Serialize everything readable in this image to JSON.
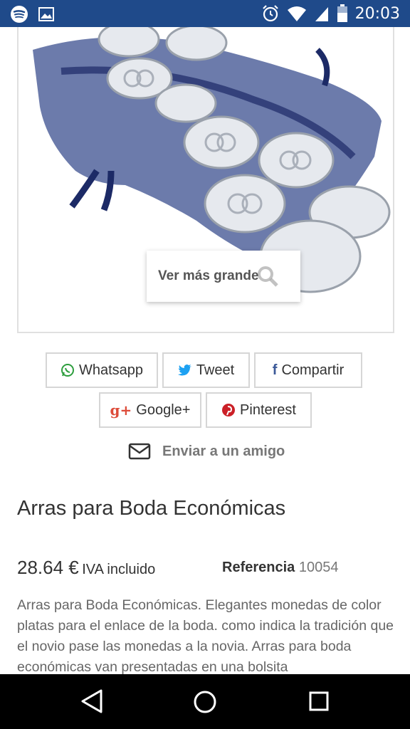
{
  "status_bar": {
    "time": "20:03",
    "icons": [
      "spotify-icon",
      "image-icon",
      "alarm-icon",
      "wifi-icon",
      "signal-icon",
      "battery-icon"
    ]
  },
  "product_image": {
    "zoom_label": "Ver más grande"
  },
  "share": {
    "whatsapp": "Whatsapp",
    "tweet": "Tweet",
    "compartir": "Compartir",
    "googleplus": "Google+",
    "pinterest": "Pinterest",
    "send_friend": "Enviar a un amigo"
  },
  "product": {
    "title": "Arras para Boda Económicas",
    "price": "28.64 €",
    "tax_note": "IVA incluido",
    "reference_label": "Referencia",
    "reference_value": "10054",
    "description": "Arras para Boda Económicas. Elegantes monedas de color platas para el enlace de la boda. como indica la tradición que el novio pase las monedas a la novia. Arras para boda económicas van presentadas en una bolsita"
  },
  "colors": {
    "status_bar": "#1f4a8a",
    "whatsapp": "#2e9e3e",
    "twitter": "#1da1f2",
    "facebook": "#3b5998",
    "googleplus": "#dd4b39",
    "pinterest": "#cb2027"
  }
}
